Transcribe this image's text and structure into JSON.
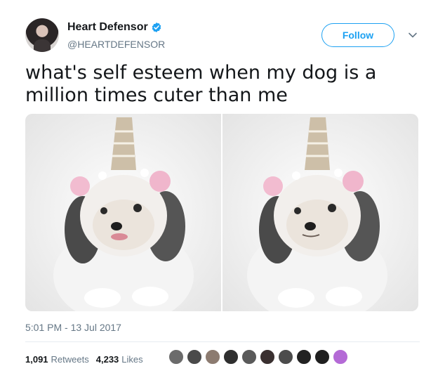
{
  "tweet": {
    "author": {
      "display_name": "Heart Defensor",
      "handle": "@HEARTDEFENSOR",
      "verified": true,
      "avatar_icon": "profile-avatar"
    },
    "follow_label": "Follow",
    "text": "what's self esteem when my dog is a million times cuter than me",
    "media": [
      {
        "icon": "dog-unicorn-photo"
      },
      {
        "icon": "dog-unicorn-photo"
      }
    ],
    "timestamp": "5:01 PM - 13 Jul 2017",
    "retweets": {
      "count": "1,091",
      "label": "Retweets"
    },
    "likes": {
      "count": "4,233",
      "label": "Likes"
    },
    "liker_avatars": [
      "#6b6b6b",
      "#4a4a4a",
      "#8c7b70",
      "#2f2f2f",
      "#5a5a5a",
      "#3a3030",
      "#4c4c4c",
      "#222222",
      "#1f1f1f",
      "#b46ad6"
    ]
  },
  "colors": {
    "accent": "#1da1f2",
    "text": "#14171a",
    "secondary_text": "#657786"
  }
}
